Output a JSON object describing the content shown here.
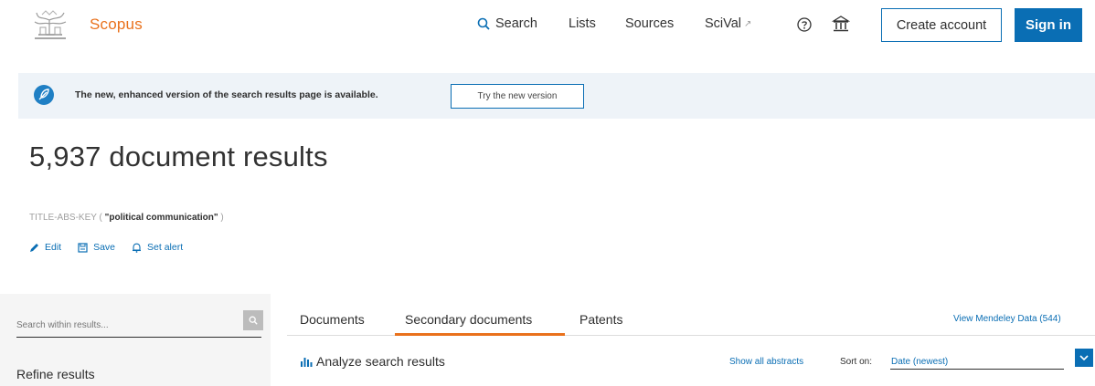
{
  "header": {
    "brand": "Scopus",
    "nav": {
      "search": "Search",
      "lists": "Lists",
      "sources": "Sources",
      "scival": "SciVal",
      "scival_ext": "↗"
    },
    "create_account": "Create account",
    "sign_in": "Sign in"
  },
  "banner": {
    "message": "The new, enhanced version of the search results page is available.",
    "button": "Try the new version"
  },
  "results": {
    "title": "5,937 document results",
    "query_prefix": "TITLE-ABS-KEY (",
    "query_term": "\"political communication\"",
    "query_suffix": ")"
  },
  "actions": {
    "edit": "Edit",
    "save": "Save",
    "set_alert": "Set alert"
  },
  "sidebar": {
    "search_placeholder": "Search within results...",
    "refine": "Refine results"
  },
  "tabs": {
    "documents": "Documents",
    "secondary": "Secondary documents",
    "patents": "Patents",
    "active": "secondary"
  },
  "mendeley": "View Mendeley Data (544)",
  "toolbar": {
    "analyze": "Analyze search results",
    "show_abstracts": "Show all abstracts",
    "sort_label": "Sort on:",
    "sort_value": "Date (newest)"
  },
  "colors": {
    "brand_orange": "#e9711c",
    "primary_blue": "#0a6eb4",
    "banner_bg": "#eef3f8"
  }
}
